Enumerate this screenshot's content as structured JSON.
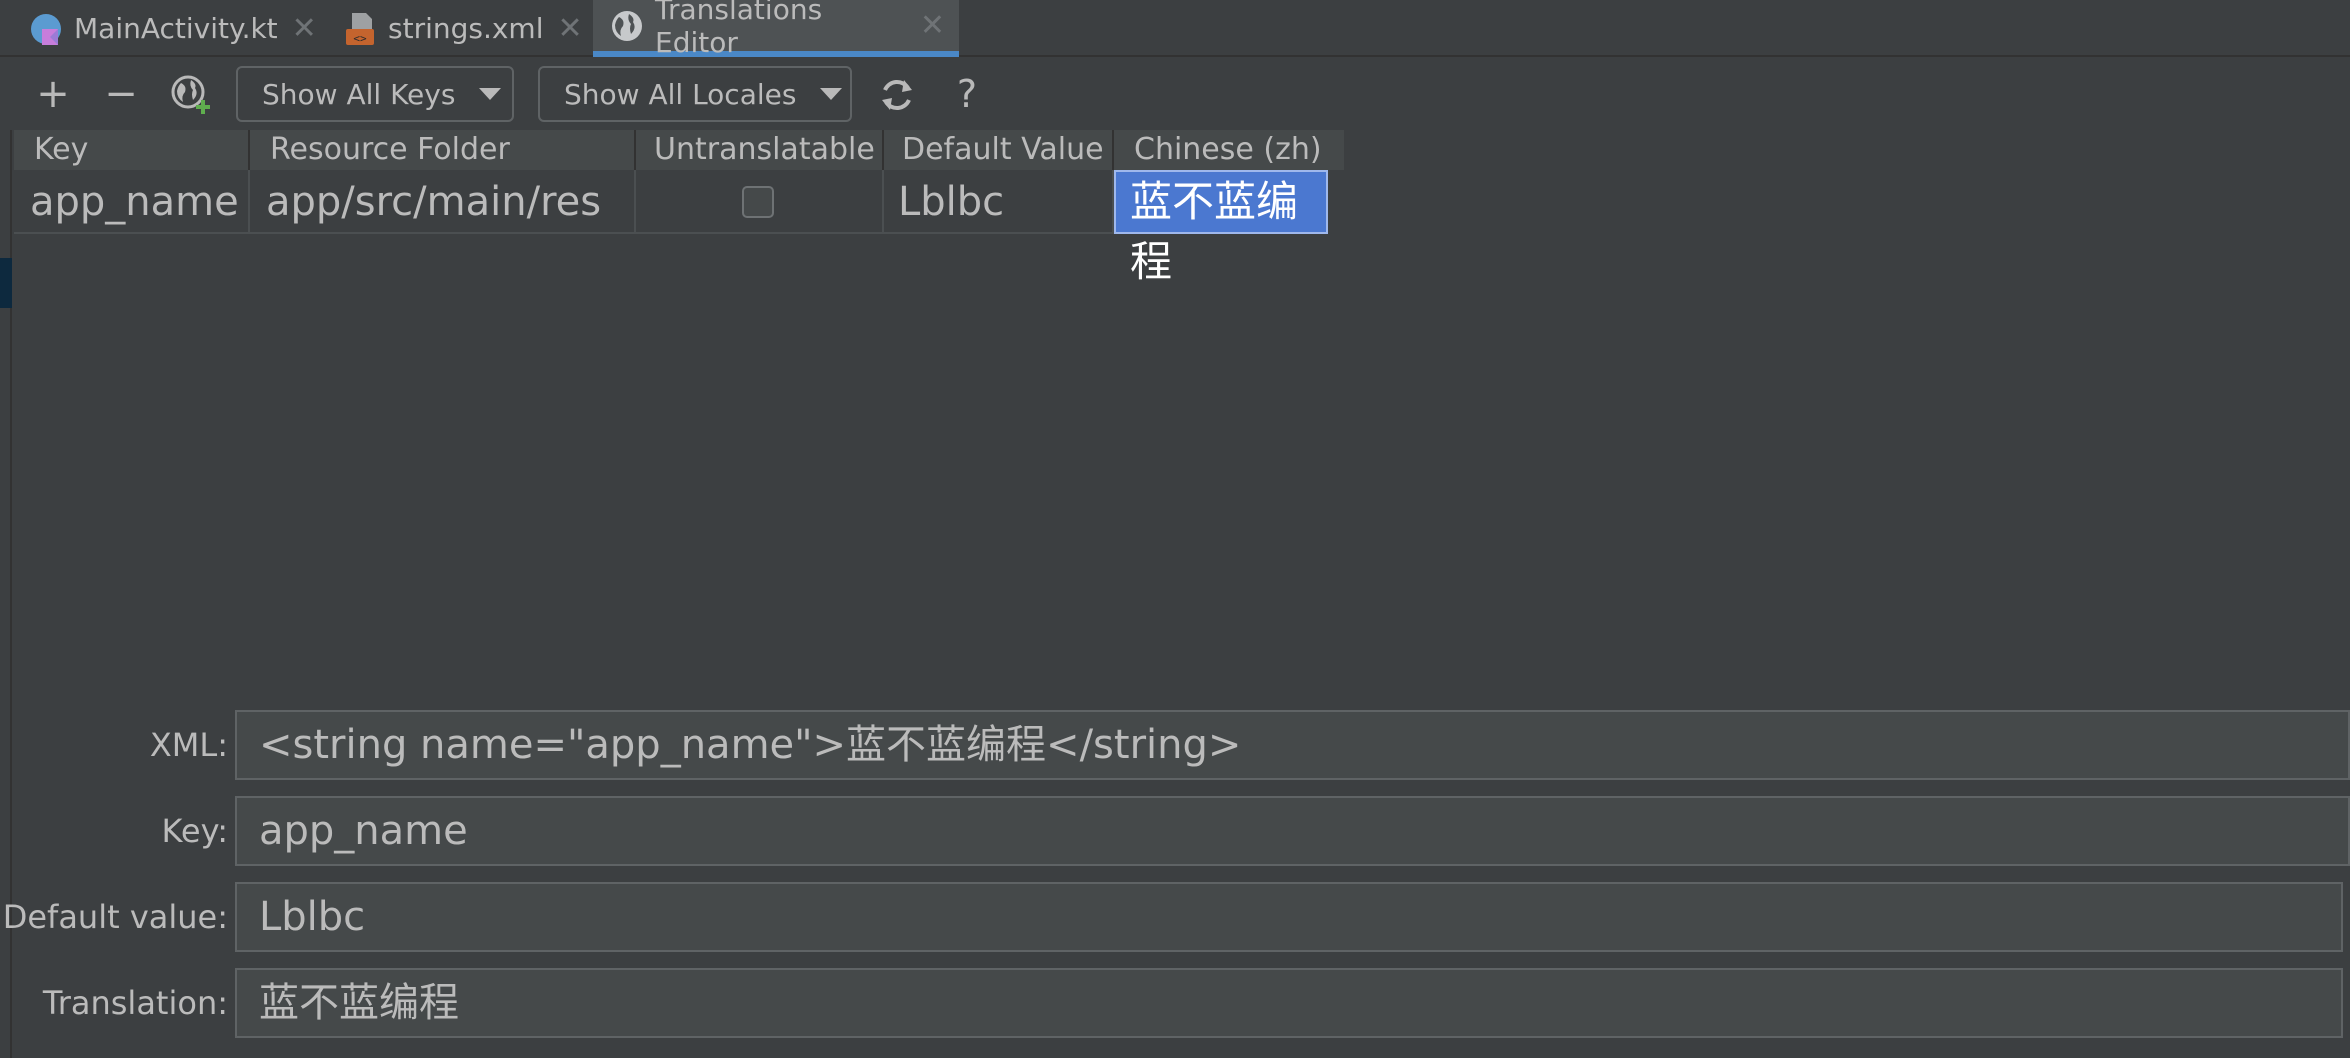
{
  "tabs": [
    {
      "label": "MainActivity.kt",
      "icon": "kotlin-class-icon"
    },
    {
      "label": "strings.xml",
      "icon": "xml-file-icon"
    },
    {
      "label": "Translations Editor",
      "icon": "globe-icon",
      "active": true
    }
  ],
  "toolbar": {
    "add": "+",
    "remove": "−",
    "add_locale_icon": "globe-add-icon",
    "keys_filter": "Show All Keys",
    "locales_filter": "Show All Locales",
    "reload_icon": "refresh-icon",
    "help": "?"
  },
  "table": {
    "columns": [
      "Key",
      "Resource Folder",
      "Untranslatable",
      "Default Value",
      "Chinese (zh)"
    ],
    "rows": [
      {
        "key": "app_name",
        "folder": "app/src/main/res",
        "untranslatable": false,
        "default": "Lblbc",
        "zh": "蓝不蓝编程"
      }
    ]
  },
  "detail": {
    "xml_label": "XML:",
    "xml_value": "<string name=\"app_name\">蓝不蓝编程</string>",
    "key_label": "Key:",
    "key_value": "app_name",
    "default_label": "Default value:",
    "default_value": "Lblbc",
    "translation_label": "Translation:",
    "translation_value": "蓝不蓝编程"
  },
  "colors": {
    "background": "#3c3f41",
    "accent": "#4a88c7",
    "selection": "#4b78d0"
  }
}
